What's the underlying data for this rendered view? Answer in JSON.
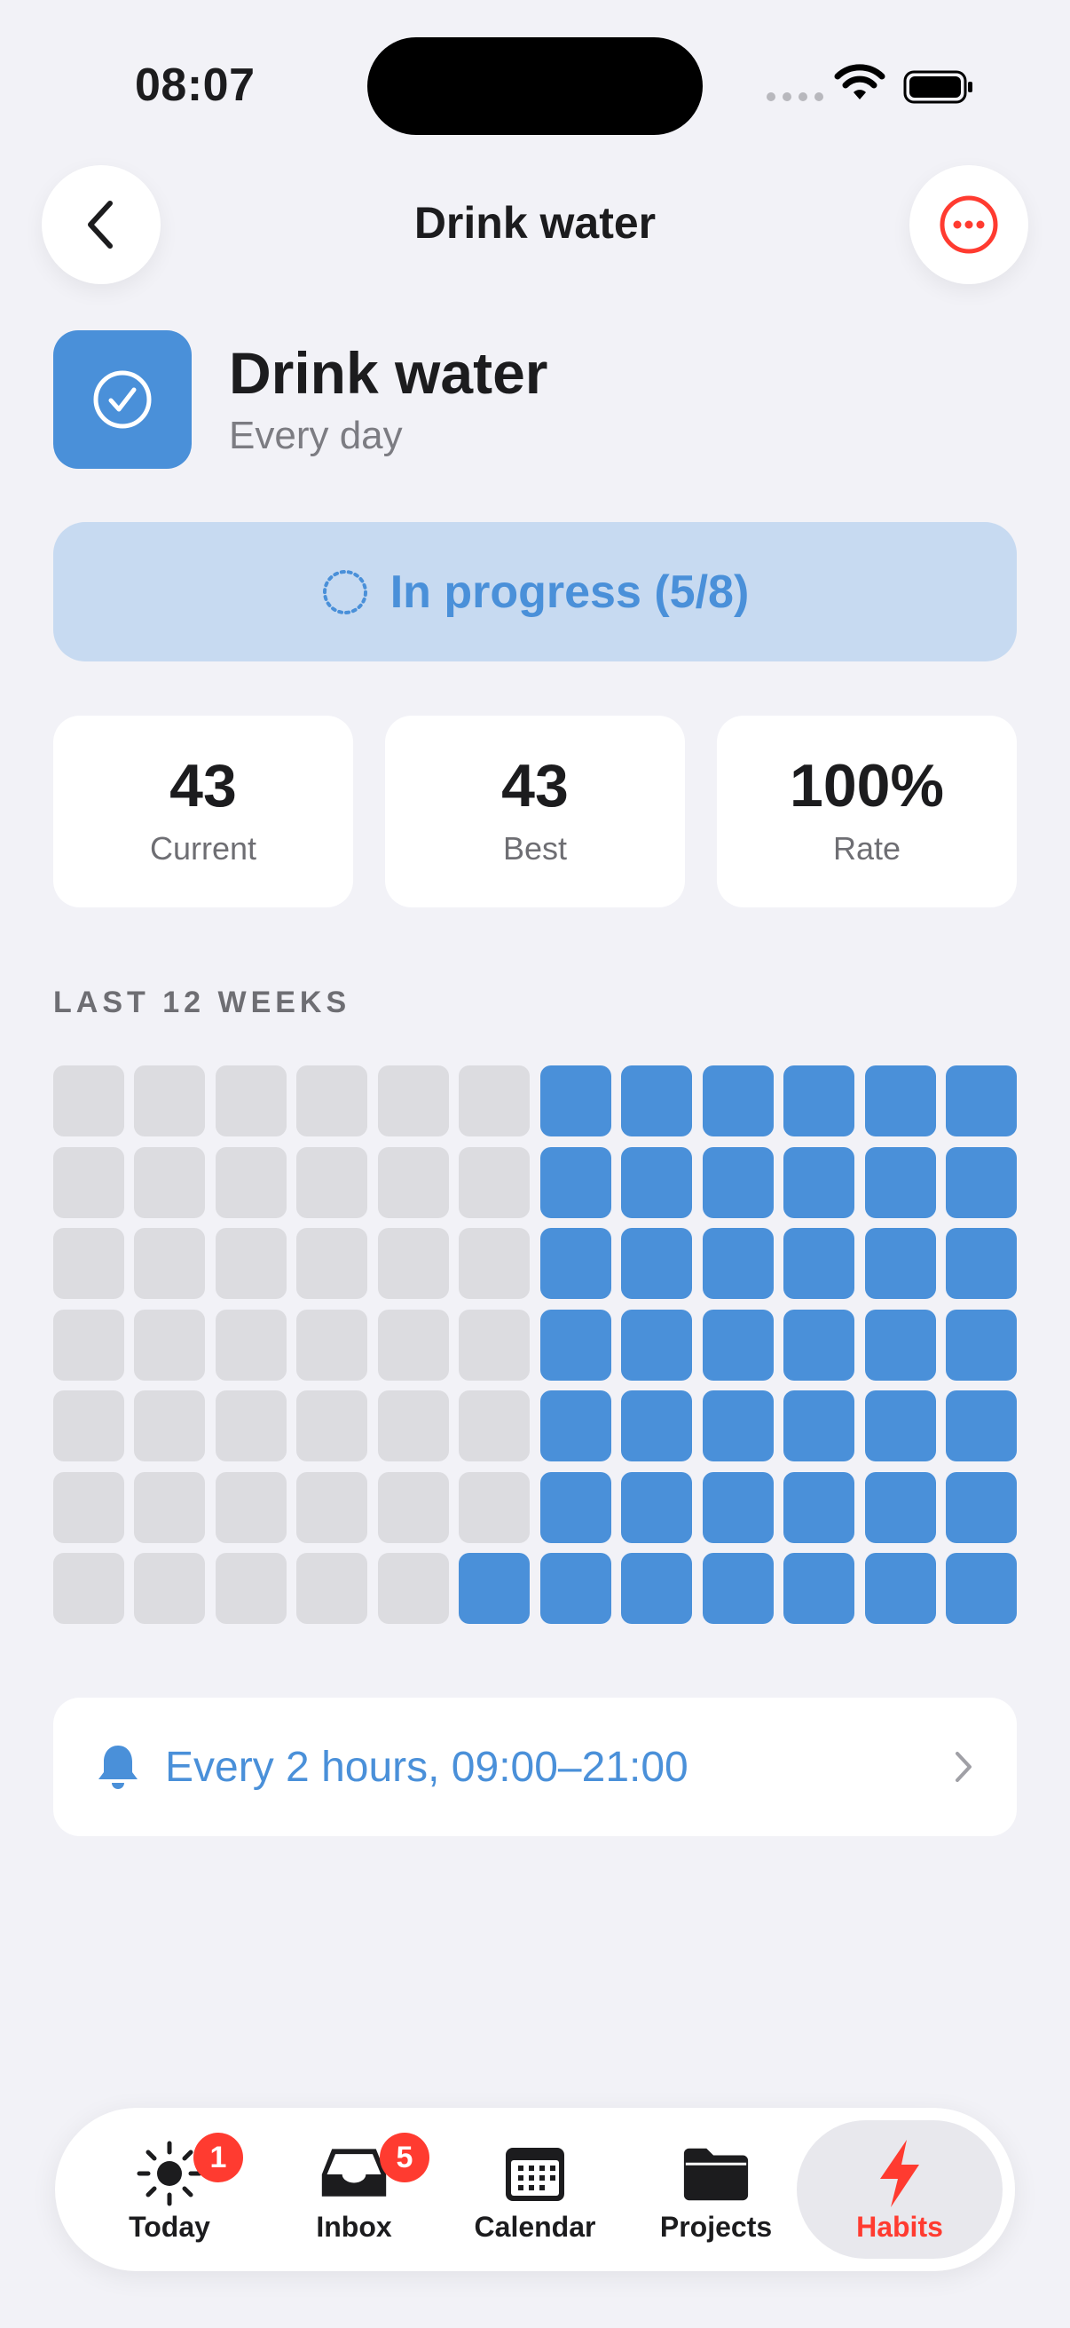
{
  "status_bar": {
    "time": "08:07"
  },
  "nav": {
    "title": "Drink water"
  },
  "habit": {
    "name": "Drink water",
    "frequency": "Every day",
    "icon": "checkmark-circle-icon",
    "color": "#4a90d9"
  },
  "progress": {
    "label": "In progress (5/8)",
    "done": 5,
    "target": 8
  },
  "stats": [
    {
      "value": "43",
      "label": "Current"
    },
    {
      "value": "43",
      "label": "Best"
    },
    {
      "value": "100%",
      "label": "Rate"
    }
  ],
  "history": {
    "label": "LAST 12 WEEKS",
    "weeks": 12,
    "days_per_week": 7,
    "completed_days": 43
  },
  "reminder": {
    "text": "Every 2 hours, 09:00–21:00",
    "icon": "bell-icon"
  },
  "tabs": [
    {
      "label": "Today",
      "icon": "sun-icon",
      "badge": "1"
    },
    {
      "label": "Inbox",
      "icon": "inbox-tray-icon",
      "badge": "5"
    },
    {
      "label": "Calendar",
      "icon": "calendar-icon",
      "badge": ""
    },
    {
      "label": "Projects",
      "icon": "folder-icon",
      "badge": ""
    },
    {
      "label": "Habits",
      "icon": "bolt-icon",
      "badge": "",
      "active": true
    }
  ],
  "colors": {
    "accent": "#4a90d9",
    "active_tab": "#ff3b30",
    "badge": "#ff3b30",
    "empty_cell": "#dcdce0"
  }
}
